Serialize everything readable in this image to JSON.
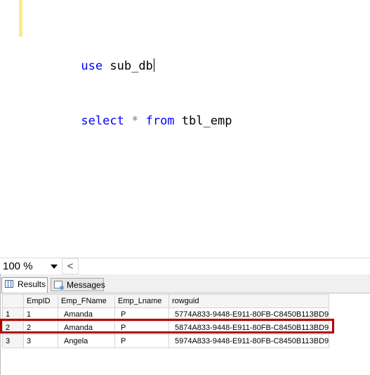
{
  "editor": {
    "lines": [
      [
        {
          "t": "use",
          "c": "kw"
        },
        {
          "t": " sub_db",
          "c": ""
        }
      ],
      [
        {
          "t": "select",
          "c": "kw"
        },
        {
          "t": " ",
          "c": ""
        },
        {
          "t": "*",
          "c": "op"
        },
        {
          "t": " ",
          "c": ""
        },
        {
          "t": "from",
          "c": "kw"
        },
        {
          "t": " tbl_emp",
          "c": ""
        }
      ]
    ]
  },
  "zoom": {
    "value": "100 %",
    "scroll_left": "<"
  },
  "tabs": {
    "results": "Results",
    "messages": "Messages"
  },
  "grid": {
    "columns": [
      "EmpID",
      "Emp_FName",
      "Emp_Lname",
      "rowguid"
    ],
    "rows": [
      {
        "num": "1",
        "EmpID": "1",
        "Emp_FName": "Amanda",
        "Emp_Lname": "P",
        "rowguid": "5774A833-9448-E911-80FB-C8450B113BD9"
      },
      {
        "num": "2",
        "EmpID": "2",
        "Emp_FName": "Amanda",
        "Emp_Lname": "P",
        "rowguid": "5874A833-9448-E911-80FB-C8450B113BD9"
      },
      {
        "num": "3",
        "EmpID": "3",
        "Emp_FName": "Angela",
        "Emp_Lname": "P",
        "rowguid": "5974A833-9448-E911-80FB-C8450B113BD9"
      }
    ]
  },
  "colors": {
    "keyword": "#0000FF",
    "operator": "#808080",
    "highlight": "#B50000"
  }
}
